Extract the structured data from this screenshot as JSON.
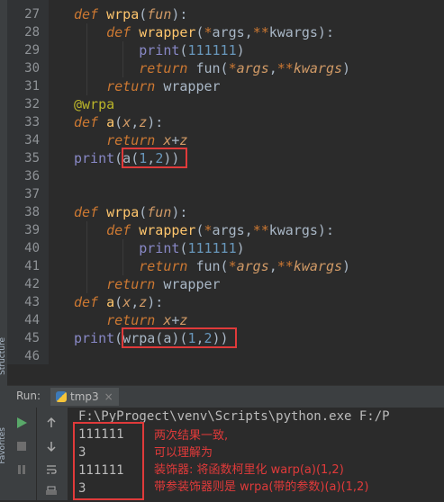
{
  "editor": {
    "line_numbers": [
      "27",
      "28",
      "29",
      "30",
      "31",
      "32",
      "33",
      "34",
      "35",
      "36",
      "37",
      "38",
      "39",
      "40",
      "41",
      "42",
      "43",
      "44",
      "45",
      "46"
    ]
  },
  "side_labels": [
    "Structure",
    "Favorites"
  ],
  "run_panel": {
    "label": "Run:",
    "tab_name": "tmp3",
    "tab_close": "×",
    "command_line": "F:\\PyProgect\\venv\\Scripts\\python.exe F:/P",
    "output_lines": [
      "111111",
      "3",
      "111111",
      "3"
    ]
  },
  "annotation": {
    "lines": [
      "两次结果一致,",
      "可以理解为",
      "装饰器: 将函数柯里化 warp(a)(1,2)",
      "带参装饰器则是 wrpa(带的参数)(a)(1,2)"
    ]
  },
  "colors": {
    "highlight_box": "#e03a3a",
    "keyword": "#cc7832",
    "function_name": "#ffc66d",
    "number": "#6897bb",
    "builtin": "#8888c6",
    "decorator": "#bbb529"
  }
}
